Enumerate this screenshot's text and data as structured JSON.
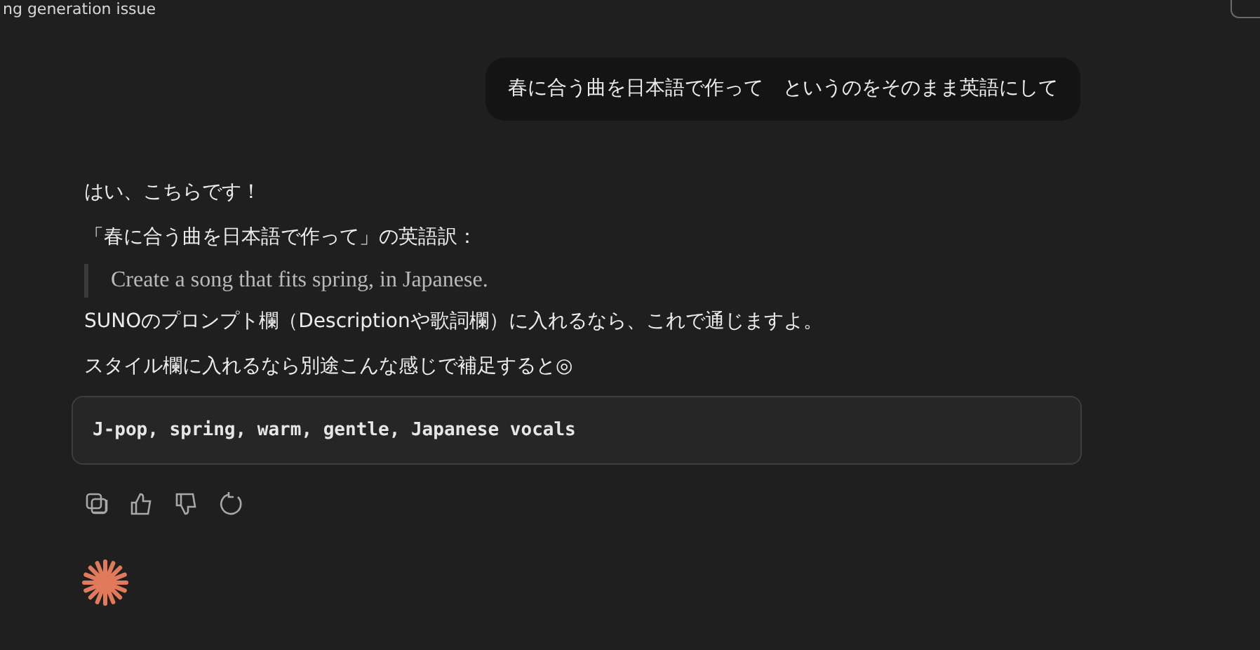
{
  "conversation": {
    "title": "ng generation issue"
  },
  "user_message": {
    "text": "春に合う曲を日本語で作って　というのをそのまま英語にして"
  },
  "assistant_message": {
    "paragraphs": [
      {
        "kind": "text",
        "text": "はい、こちらです！"
      },
      {
        "kind": "text",
        "text": "「春に合う曲を日本語で作って」の英語訳："
      },
      {
        "kind": "quote",
        "text": "Create a song that fits spring, in Japanese."
      },
      {
        "kind": "text",
        "text": "SUNOのプロンプト欄（Descriptionや歌詞欄）に入れるなら、これで通じますよ。"
      },
      {
        "kind": "text",
        "text": "スタイル欄に入れるなら別途こんな感じで補足すると◎"
      },
      {
        "kind": "code",
        "text": "J-pop, spring, warm, gentle, Japanese vocals"
      }
    ]
  }
}
